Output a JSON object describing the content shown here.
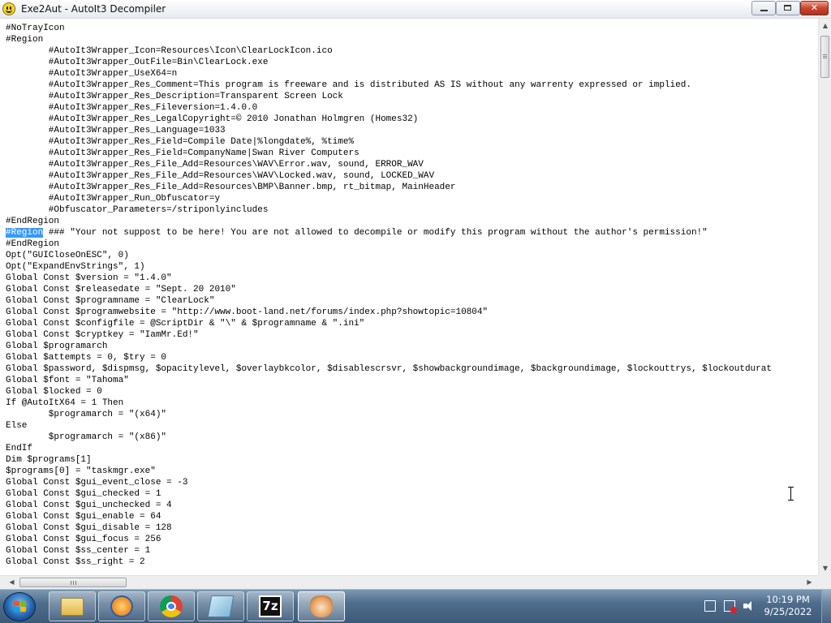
{
  "window": {
    "title": "Exe2Aut - AutoIt3 Decompiler",
    "controls": {
      "minimize": "minimize",
      "maximize": "restore",
      "close": "✕"
    }
  },
  "editor": {
    "selection": "#Region",
    "lines": [
      "#NoTrayIcon",
      "#Region",
      "        #AutoIt3Wrapper_Icon=Resources\\Icon\\ClearLockIcon.ico",
      "        #AutoIt3Wrapper_OutFile=Bin\\ClearLock.exe",
      "        #AutoIt3Wrapper_UseX64=n",
      "        #AutoIt3Wrapper_Res_Comment=This program is freeware and is distributed AS IS without any warrenty expressed or implied.",
      "        #AutoIt3Wrapper_Res_Description=Transparent Screen Lock",
      "        #AutoIt3Wrapper_Res_Fileversion=1.4.0.0",
      "        #AutoIt3Wrapper_Res_LegalCopyright=© 2010 Jonathan Holmgren (Homes32)",
      "        #AutoIt3Wrapper_Res_Language=1033",
      "        #AutoIt3Wrapper_Res_Field=Compile Date|%longdate%, %time%",
      "        #AutoIt3Wrapper_Res_Field=CompanyName|Swan River Computers",
      "        #AutoIt3Wrapper_Res_File_Add=Resources\\WAV\\Error.wav, sound, ERROR_WAV",
      "        #AutoIt3Wrapper_Res_File_Add=Resources\\WAV\\Locked.wav, sound, LOCKED_WAV",
      "        #AutoIt3Wrapper_Res_File_Add=Resources\\BMP\\Banner.bmp, rt_bitmap, MainHeader",
      "        #AutoIt3Wrapper_Run_Obfuscator=y",
      "        #Obfuscator_Parameters=/striponlyincludes",
      "#EndRegion",
      " ### \"Your not suppost to be here! You are not allowed to decompile or modify this program without the author's permission!\"",
      "#EndRegion",
      "Opt(\"GUICloseOnESC\", 0)",
      "Opt(\"ExpandEnvStrings\", 1)",
      "Global Const $version = \"1.4.0\"",
      "Global Const $releasedate = \"Sept. 20 2010\"",
      "Global Const $programname = \"ClearLock\"",
      "Global Const $programwebsite = \"http://www.boot-land.net/forums/index.php?showtopic=10804\"",
      "Global Const $configfile = @ScriptDir & \"\\\" & $programname & \".ini\"",
      "Global Const $cryptkey = \"IamMr.Ed!\"",
      "Global $programarch",
      "Global $attempts = 0, $try = 0",
      "Global $password, $dispmsg, $opacitylevel, $overlaybkcolor, $disablescrsvr, $showbackgroundimage, $backgroundimage, $lockouttrys, $lockoutdurat",
      "Global $font = \"Tahoma\"",
      "Global $locked = 0",
      "If @AutoItX64 = 1 Then",
      "        $programarch = \"(x64)\"",
      "Else",
      "        $programarch = \"(x86)\"",
      "EndIf",
      "Dim $programs[1]",
      "$programs[0] = \"taskmgr.exe\"",
      "Global Const $gui_event_close = -3",
      "Global Const $gui_checked = 1",
      "Global Const $gui_unchecked = 4",
      "Global Const $gui_enable = 64",
      "Global Const $gui_disable = 128",
      "Global Const $gui_focus = 256",
      "Global Const $ss_center = 1",
      "Global Const $ss_right = 2"
    ],
    "selected_line": 18
  },
  "taskbar": {
    "start": "start-orb",
    "apps": [
      {
        "name": "explorer",
        "icon": "folder-icon"
      },
      {
        "name": "media-player",
        "icon": "media-player-icon"
      },
      {
        "name": "chrome",
        "icon": "chrome-icon"
      },
      {
        "name": "notepad",
        "icon": "notepad-icon"
      },
      {
        "name": "7-zip",
        "icon": "7zip-icon",
        "label": "7z"
      },
      {
        "name": "exe2aut",
        "icon": "exe2aut-icon"
      }
    ],
    "tray_icons": [
      "action-center-icon",
      "network-icon",
      "volume-icon"
    ],
    "clock": {
      "time": "10:19 PM",
      "date": "9/25/2022"
    }
  },
  "colors": {
    "selection": "#3399ff",
    "taskbar": "#4f6d8c",
    "close_button": "#c9452c"
  }
}
